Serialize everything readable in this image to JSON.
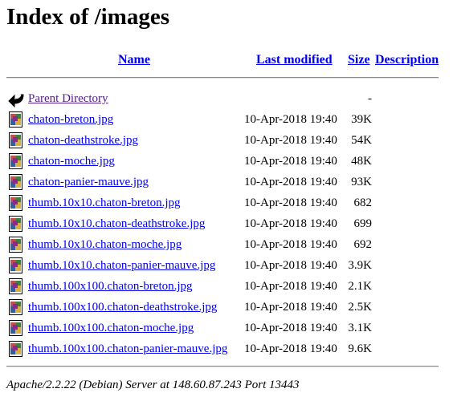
{
  "page": {
    "title": "Index of /images"
  },
  "columns": {
    "name": "Name",
    "last_modified": "Last modified",
    "size": "Size",
    "description": "Description"
  },
  "parent": {
    "label": "Parent Directory",
    "size": "-",
    "icon": "back-arrow-icon"
  },
  "files": [
    {
      "name": "chaton-breton.jpg",
      "modified": "10-Apr-2018 19:40",
      "size": "39K"
    },
    {
      "name": "chaton-deathstroke.jpg",
      "modified": "10-Apr-2018 19:40",
      "size": "54K"
    },
    {
      "name": "chaton-moche.jpg",
      "modified": "10-Apr-2018 19:40",
      "size": "48K"
    },
    {
      "name": "chaton-panier-mauve.jpg",
      "modified": "10-Apr-2018 19:40",
      "size": "93K"
    },
    {
      "name": "thumb.10x10.chaton-breton.jpg",
      "modified": "10-Apr-2018 19:40",
      "size": "682"
    },
    {
      "name": "thumb.10x10.chaton-deathstroke.jpg",
      "modified": "10-Apr-2018 19:40",
      "size": "699"
    },
    {
      "name": "thumb.10x10.chaton-moche.jpg",
      "modified": "10-Apr-2018 19:40",
      "size": "692"
    },
    {
      "name": "thumb.10x10.chaton-panier-mauve.jpg",
      "modified": "10-Apr-2018 19:40",
      "size": "3.9K"
    },
    {
      "name": "thumb.100x100.chaton-breton.jpg",
      "modified": "10-Apr-2018 19:40",
      "size": "2.1K"
    },
    {
      "name": "thumb.100x100.chaton-deathstroke.jpg",
      "modified": "10-Apr-2018 19:40",
      "size": "2.5K"
    },
    {
      "name": "thumb.100x100.chaton-moche.jpg",
      "modified": "10-Apr-2018 19:40",
      "size": "3.1K"
    },
    {
      "name": "thumb.100x100.chaton-panier-mauve.jpg",
      "modified": "10-Apr-2018 19:40",
      "size": "9.6K"
    }
  ],
  "file_icon": "image-file-icon",
  "colors": {
    "link": "#0000ee",
    "visited": "#551a8b"
  },
  "footer": {
    "address": "Apache/2.2.22 (Debian) Server at 148.60.87.243 Port 13443"
  }
}
